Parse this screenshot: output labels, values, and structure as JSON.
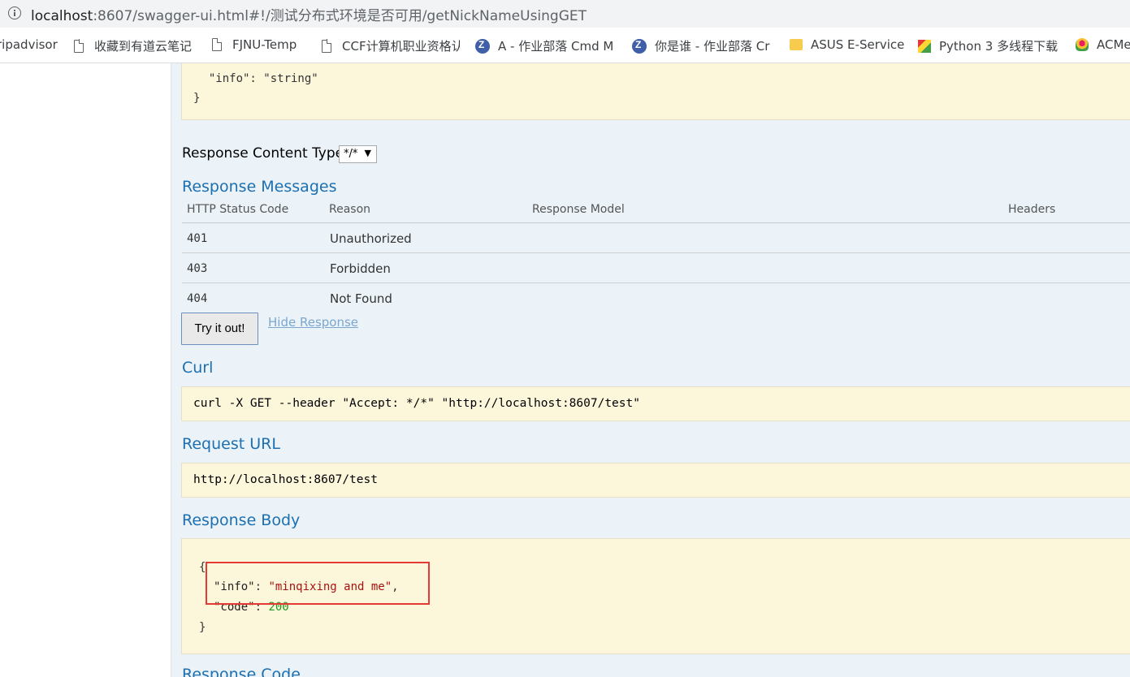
{
  "browser": {
    "url_host": "localhost",
    "url_rest": ":8607/swagger-ui.html#!/测试分布式环境是否可用/getNickNameUsingGET",
    "bookmarks": [
      {
        "label": "ripadvisor",
        "icon": "none"
      },
      {
        "label": "收藏到有道云笔记",
        "icon": "page-icon"
      },
      {
        "label": "FJNU-Temp",
        "icon": "page-icon"
      },
      {
        "label": "CCF计算机职业资格认",
        "icon": "page-icon"
      },
      {
        "label": "A - 作业部落 Cmd M",
        "icon": "zuoye-icon"
      },
      {
        "label": "你是谁 - 作业部落 Cr",
        "icon": "zuoye-icon"
      },
      {
        "label": "ASUS E-Service",
        "icon": "folder-icon"
      },
      {
        "label": "Python 3 多线程下载",
        "icon": "python-icon"
      },
      {
        "label": "ACMe",
        "icon": "acm-icon"
      }
    ]
  },
  "model_schema": {
    "line1": "  \"info\": \"string\"",
    "line2": "}"
  },
  "response_content_type": {
    "label": "Response Content Type",
    "value": "*/*"
  },
  "response_messages": {
    "heading": "Response Messages",
    "columns": [
      "HTTP Status Code",
      "Reason",
      "Response Model",
      "Headers"
    ],
    "rows": [
      {
        "code": "401",
        "reason": "Unauthorized"
      },
      {
        "code": "403",
        "reason": "Forbidden"
      },
      {
        "code": "404",
        "reason": "Not Found"
      }
    ]
  },
  "actions": {
    "try_label": "Try it out!",
    "hide_label": "Hide Response"
  },
  "curl": {
    "heading": "Curl",
    "command": "curl -X GET --header \"Accept: */*\" \"http://localhost:8607/test\""
  },
  "request_url": {
    "heading": "Request URL",
    "value": "http://localhost:8607/test"
  },
  "response_body": {
    "heading": "Response Body",
    "open": "{",
    "info_key": "\"info\"",
    "info_value": "\"minqixing and me\"",
    "code_key": "\"code\"",
    "code_value": "200",
    "close": "}"
  },
  "response_code": {
    "heading": "Response Code"
  }
}
